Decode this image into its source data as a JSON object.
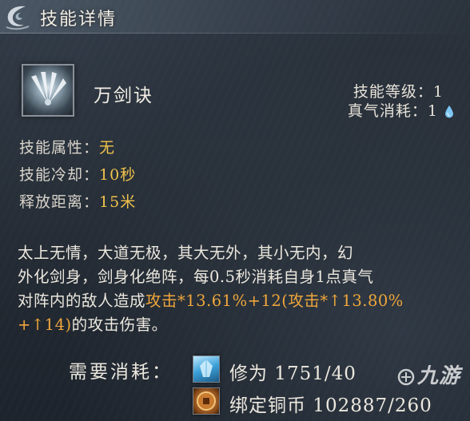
{
  "header": {
    "title": "技能详情"
  },
  "skill": {
    "icon": "sword-fan-icon",
    "name": "万剑诀",
    "level_label": "技能等级：",
    "level_value": "1",
    "qi_label": "真气消耗：",
    "qi_value": "1",
    "qi_icon": "water-drop-icon"
  },
  "attributes": [
    {
      "label": "技能属性：",
      "value": "无"
    },
    {
      "label": "技能冷却：",
      "value": "10秒"
    },
    {
      "label": "释放距离：",
      "value": "15米"
    }
  ],
  "description": {
    "line1": "太上无情，大道无极，其大无外，其小无内，幻",
    "line2": "外化剑身，剑身化绝阵，每0.5秒消耗自身1点真气",
    "line3_prefix": "对阵内的敌人造成",
    "line3_highlight": "攻击*13.61%+12(攻击*↑13.80%",
    "line4_highlight": "+↑14)",
    "line4_suffix": "的攻击伤害。"
  },
  "cost": {
    "label": "需要消耗：",
    "items": [
      {
        "icon": "cultivation-crystal-icon",
        "text": "修为 1751/40"
      },
      {
        "icon": "bound-copper-coin-icon",
        "text": "绑定铜币 102887/260"
      }
    ]
  },
  "watermark": {
    "text": "九游"
  },
  "colors": {
    "value_gold": "#f0c24a",
    "highlight_orange": "#f0a63a",
    "text_light": "#ece8de",
    "panel_bg": "#232a33"
  }
}
